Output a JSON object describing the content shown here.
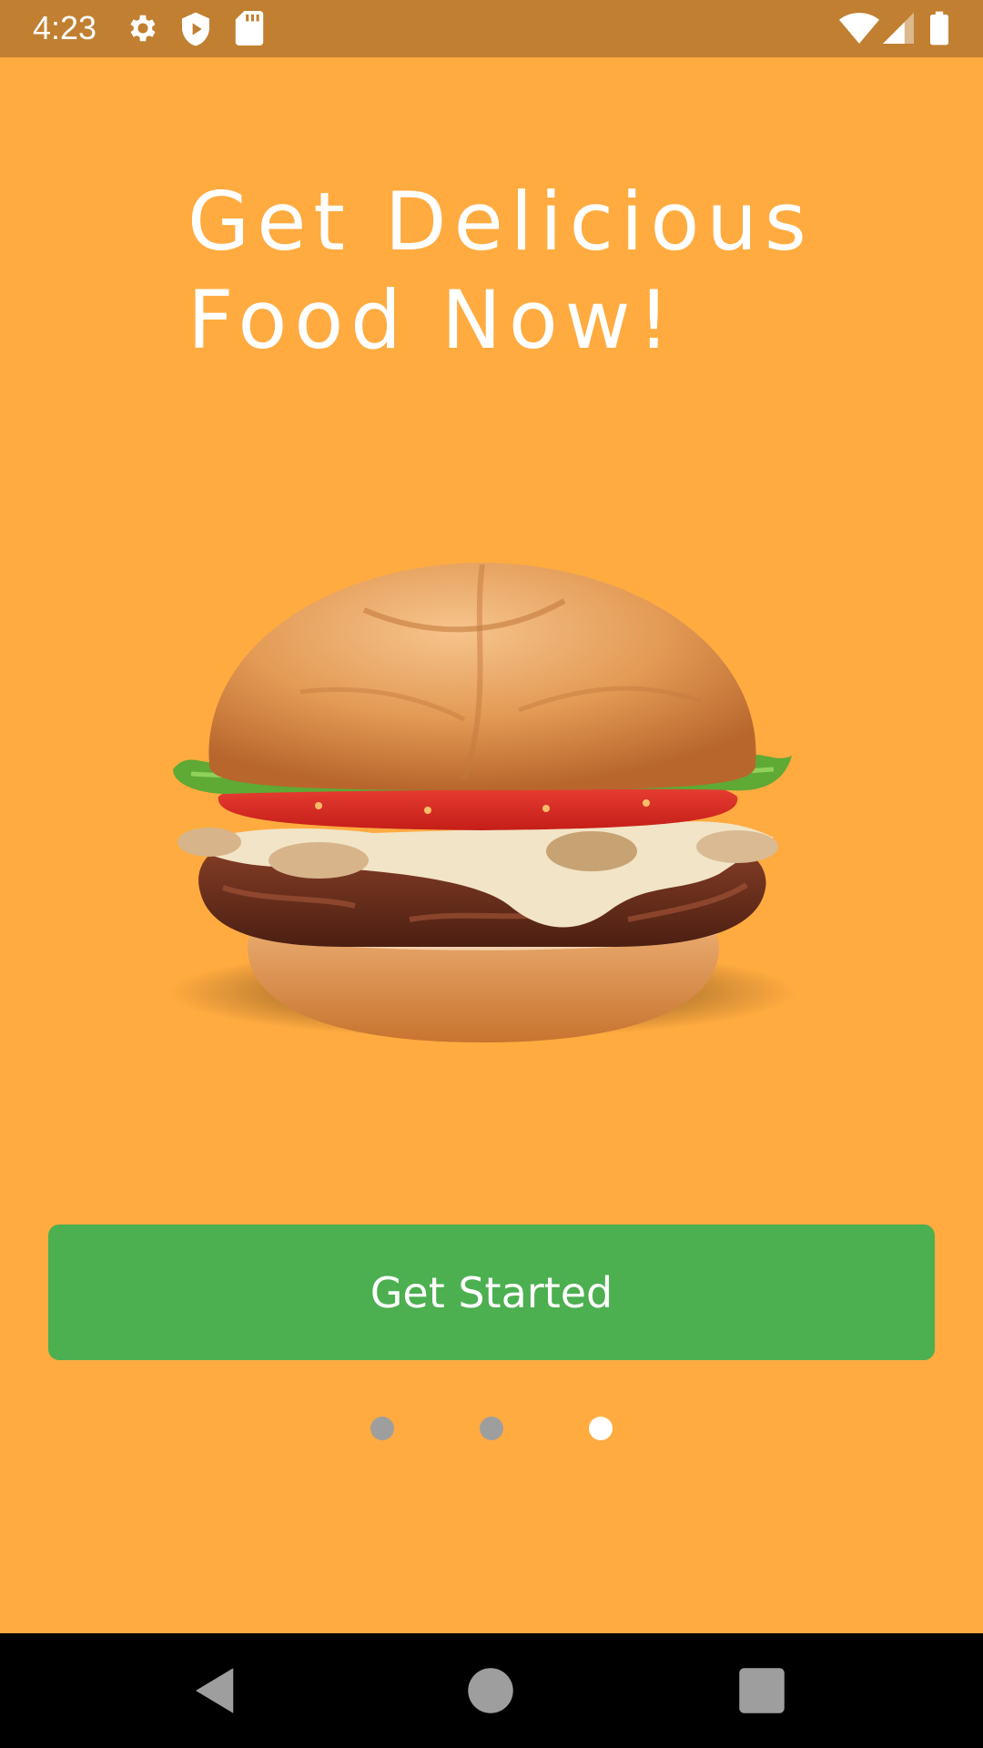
{
  "status_bar": {
    "time": "4:23",
    "left_icons": [
      "settings-icon",
      "shield-icon",
      "sd-card-icon"
    ],
    "right_icons": [
      "wifi-icon",
      "signal-icon",
      "battery-icon"
    ],
    "background": "#C17F31"
  },
  "onboarding": {
    "headline_line1": "Get Delicious",
    "headline_line2": "Food Now!",
    "image": "burger-illustration",
    "background": "#FFAB40"
  },
  "cta": {
    "label": "Get Started",
    "color": "#4CAF50"
  },
  "pager": {
    "count": 3,
    "active_index": 2,
    "active_color": "#FFFFFF",
    "inactive_color": "#9E9E9E"
  },
  "nav_bar": {
    "buttons": [
      "back-icon",
      "home-icon",
      "recents-icon"
    ]
  }
}
